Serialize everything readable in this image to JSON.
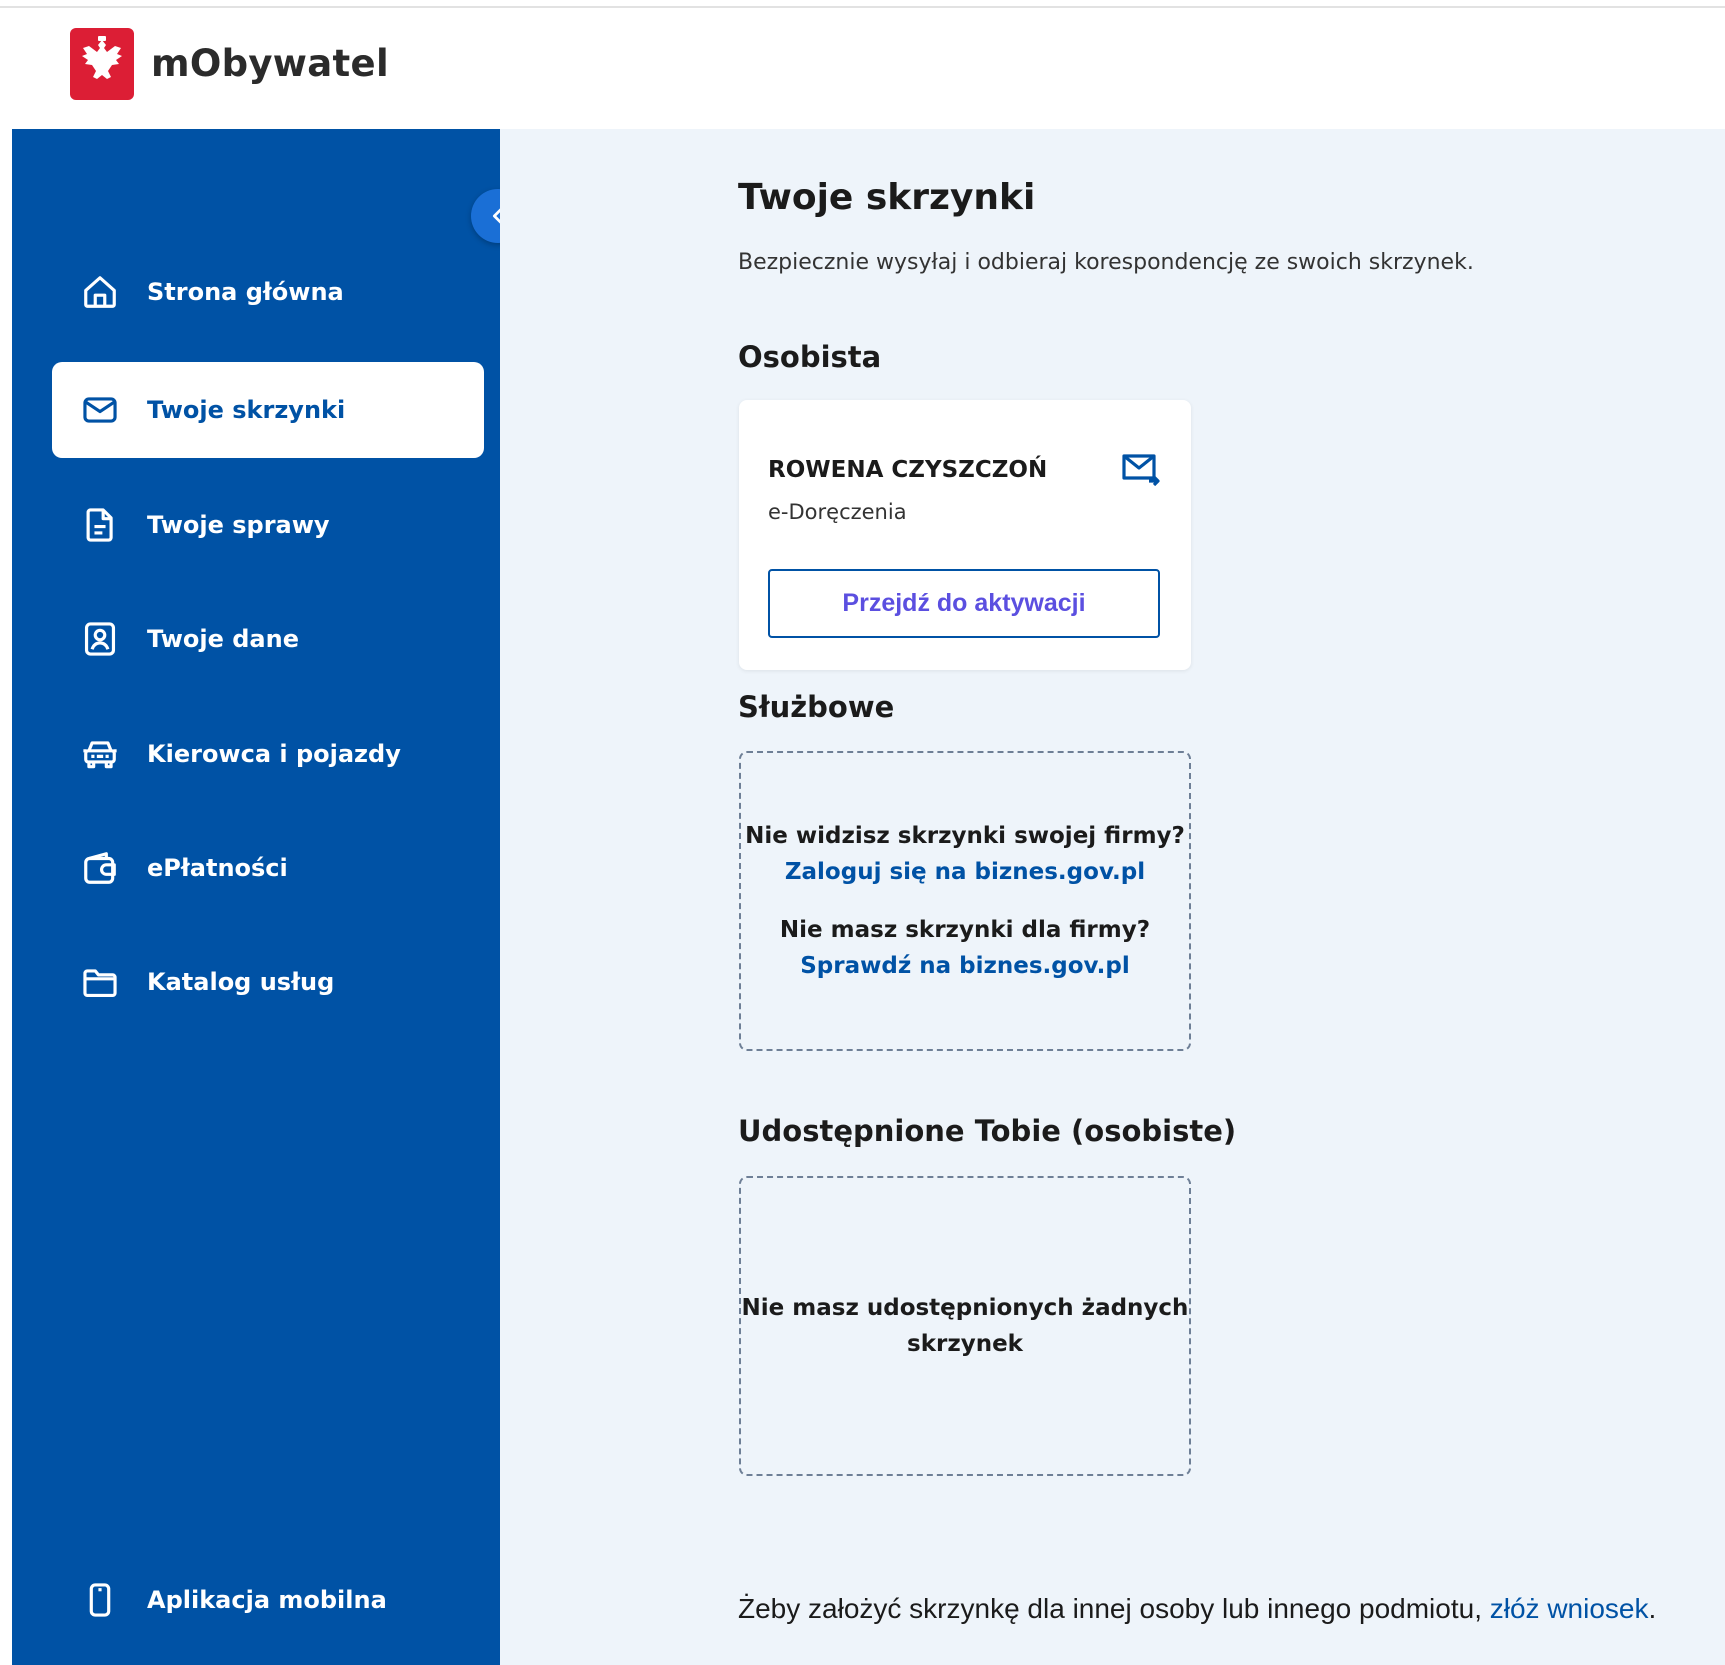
{
  "app": {
    "title": "mObywatel"
  },
  "sidebar": {
    "items": [
      {
        "label": "Strona główna",
        "icon": "home-icon"
      },
      {
        "label": "Twoje skrzynki",
        "icon": "mail-icon",
        "active": true
      },
      {
        "label": "Twoje sprawy",
        "icon": "document-icon"
      },
      {
        "label": "Twoje dane",
        "icon": "person-badge-icon"
      },
      {
        "label": "Kierowca i pojazdy",
        "icon": "car-icon"
      },
      {
        "label": "ePłatności",
        "icon": "wallet-icon"
      },
      {
        "label": "Katalog usług",
        "icon": "folder-icon"
      }
    ],
    "bottom_item": {
      "label": "Aplikacja mobilna",
      "icon": "phone-icon"
    }
  },
  "main": {
    "title": "Twoje skrzynki",
    "subtitle": "Bezpiecznie wysyłaj i odbieraj korespondencję ze swoich skrzynek.",
    "personal": {
      "heading": "Osobista",
      "card": {
        "name": "ROWENA CZYSZCZOŃ",
        "type": "e-Doręczenia",
        "button_label": "Przejdź do aktywacji"
      }
    },
    "business": {
      "heading": "Służbowe",
      "question1": "Nie widzisz skrzynki swojej firmy?",
      "link1": "Zaloguj się na biznes.gov.pl",
      "question2": "Nie masz skrzynki dla firmy?",
      "link2": "Sprawdź na biznes.gov.pl"
    },
    "shared": {
      "heading": "Udostępnione Tobie (osobiste)",
      "empty_line1": "Nie masz udostępnionych żadnych",
      "empty_line2": "skrzynek"
    },
    "footer": {
      "text": "Żeby założyć skrzynkę dla innej osoby lub innego podmiotu, ",
      "link": "złóż wniosek",
      "end": "."
    }
  },
  "colors": {
    "sidebar": "#0052a5",
    "main_bg": "#eef4fa",
    "link": "#0052a5",
    "button_text": "#5b4fe0",
    "logo_red": "#dc1e35"
  }
}
